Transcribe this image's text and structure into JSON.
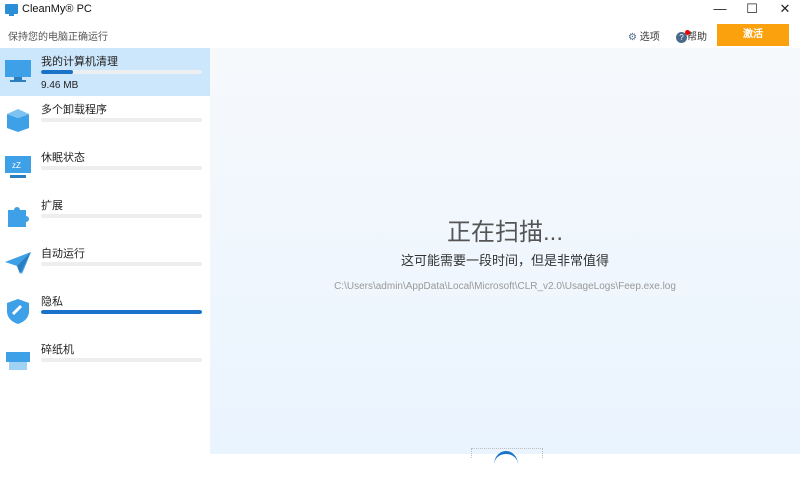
{
  "window": {
    "title": "CleanMy® PC",
    "minimize": "—",
    "maximize": "☐",
    "close": "✕"
  },
  "header": {
    "subtitle": "保持您的电脑正确运行",
    "options_label": "选项",
    "help_label": "帮助",
    "activate_label": "激活"
  },
  "sidebar": {
    "items": [
      {
        "label": "我的计算机清理",
        "progress": 20,
        "size": "9.46 MB",
        "icon": "monitor-icon"
      },
      {
        "label": "多个卸载程序",
        "progress": 0,
        "icon": "box-icon"
      },
      {
        "label": "休眠状态",
        "progress": 0,
        "icon": "sleep-monitor-icon"
      },
      {
        "label": "扩展",
        "progress": 0,
        "icon": "puzzle-icon"
      },
      {
        "label": "自动运行",
        "progress": 0,
        "icon": "paper-plane-icon"
      },
      {
        "label": "隐私",
        "progress": 100,
        "icon": "shield-icon"
      },
      {
        "label": "碎纸机",
        "progress": 0,
        "icon": "shredder-icon"
      }
    ]
  },
  "main": {
    "title": "正在扫描...",
    "subtitle": "这可能需要一段时间，但是非常值得",
    "path": "C:\\Users\\admin\\AppData\\Local\\Microsoft\\CLR_v2.0\\UsageLogs\\Feep.exe.log"
  },
  "colors": {
    "accent": "#1a73c8",
    "activate": "#fba10e",
    "selected": "#cce6fb"
  }
}
